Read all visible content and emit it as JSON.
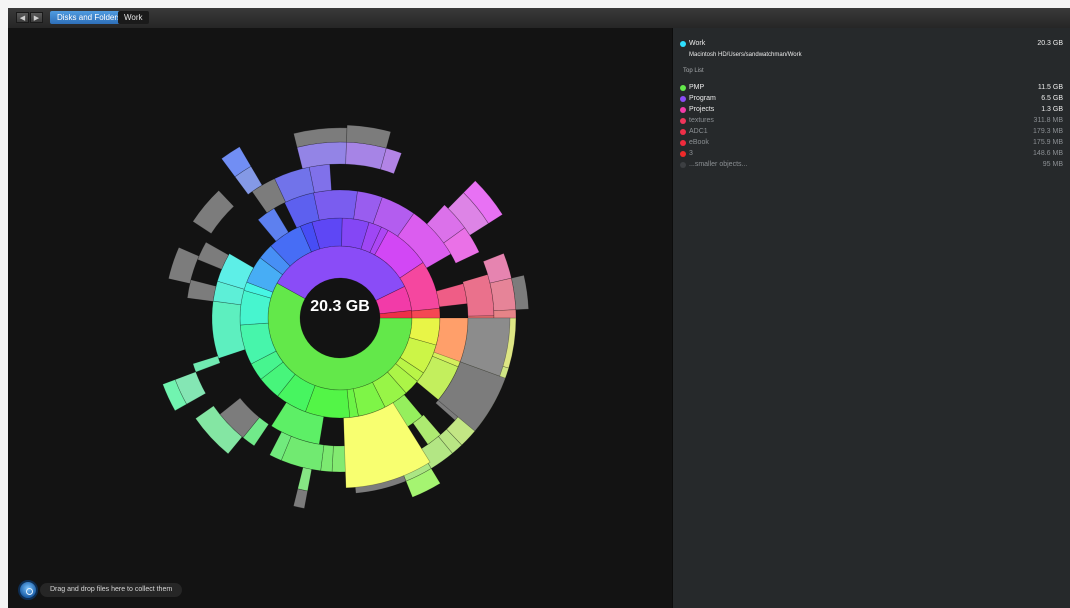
{
  "toolbar": {
    "back_icon": "◀",
    "forward_icon": "▶",
    "breadcrumb": [
      "Disks and Folders",
      "Work"
    ]
  },
  "center_label": "20.3 GB",
  "drop_hint": "Drag and drop files here to collect them",
  "sidebar": {
    "title": "Work",
    "title_color": "#2fe0ff",
    "size": "20.3  GB",
    "path": "Macintosh HD/Users/sandwatchman/Work",
    "section_label": "Top List",
    "items": [
      {
        "name": "PMP",
        "size": "11.5  GB",
        "color": "#63e84a",
        "dim": false
      },
      {
        "name": "Program",
        "size": "6.5  GB",
        "color": "#8a4cf7",
        "dim": false
      },
      {
        "name": "Projects",
        "size": "1.3  GB",
        "color": "#f23ba8",
        "dim": false
      },
      {
        "name": "textures",
        "size": "311.8  MB",
        "color": "#f0355b",
        "dim": true
      },
      {
        "name": "ADC1",
        "size": "179.3  MB",
        "color": "#ee2f48",
        "dim": true
      },
      {
        "name": "eBook",
        "size": "175.9  MB",
        "color": "#ef2a3c",
        "dim": true
      },
      {
        "name": "3",
        "size": "148.6  MB",
        "color": "#ee2a2a",
        "dim": true
      },
      {
        "name": "...smaller objects...",
        "size": "95    MB",
        "color": "#3c3f42",
        "dim": true
      }
    ]
  }
}
